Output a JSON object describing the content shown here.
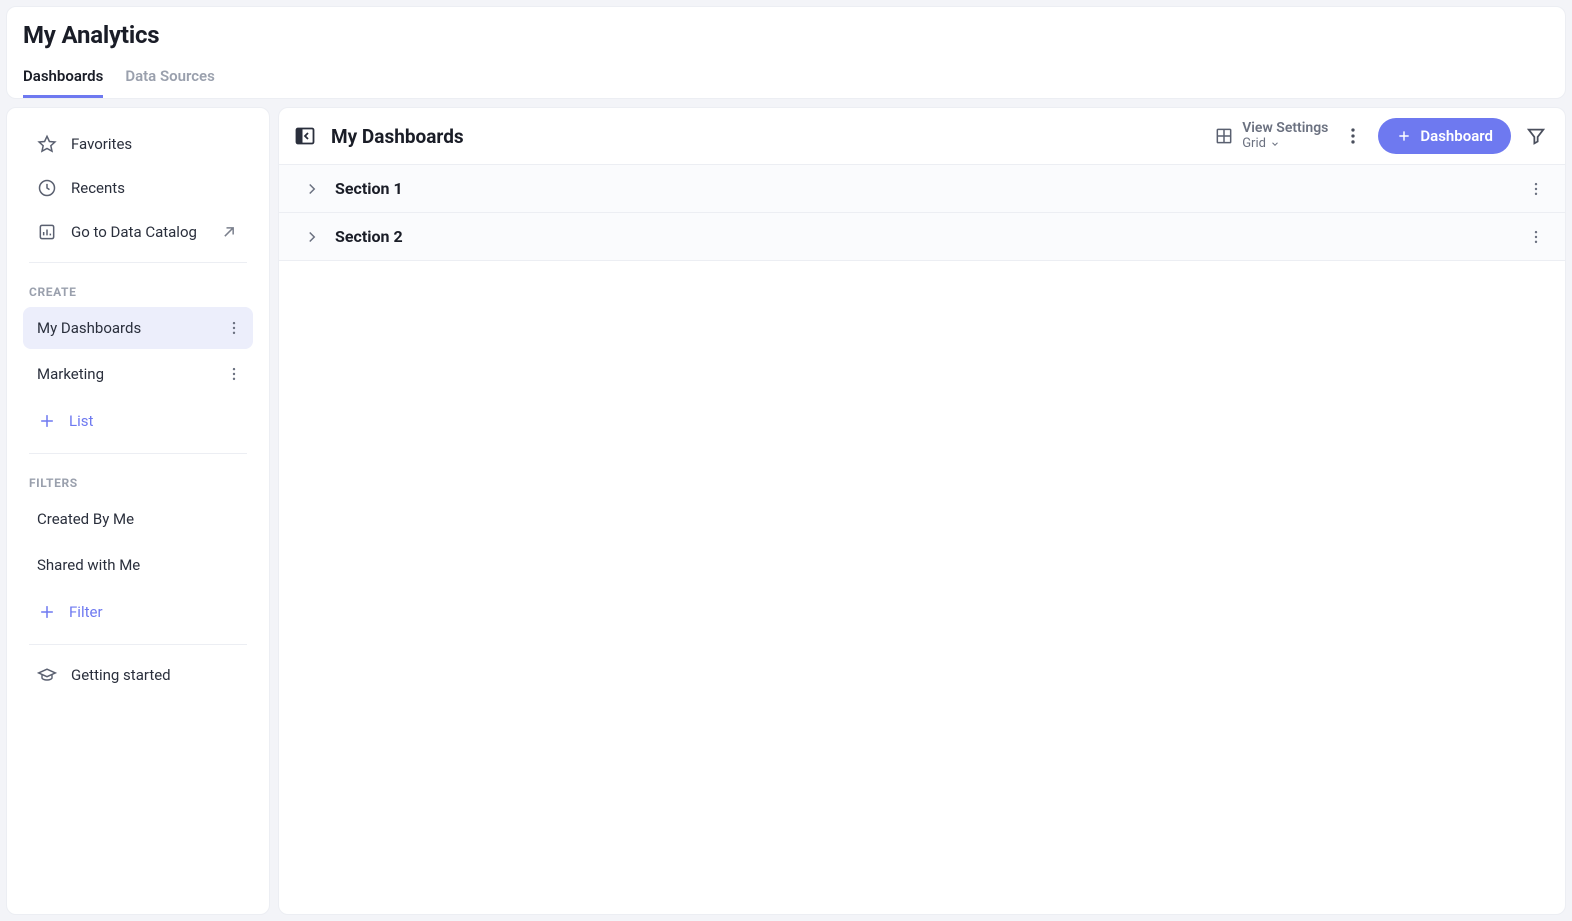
{
  "header": {
    "title": "My Analytics",
    "tabs": [
      {
        "label": "Dashboards",
        "active": true
      },
      {
        "label": "Data Sources",
        "active": false
      }
    ]
  },
  "sidebar": {
    "nav": {
      "favorites": "Favorites",
      "recents": "Recents",
      "catalog": "Go to Data Catalog"
    },
    "create": {
      "header": "CREATE",
      "items": [
        {
          "label": "My Dashboards",
          "active": true
        },
        {
          "label": "Marketing",
          "active": false
        }
      ],
      "add_label": "List"
    },
    "filters": {
      "header": "FILTERS",
      "items": [
        {
          "label": "Created By Me"
        },
        {
          "label": "Shared with Me"
        }
      ],
      "add_label": "Filter"
    },
    "getting_started": "Getting started"
  },
  "main": {
    "title": "My Dashboards",
    "view_settings": {
      "label": "View Settings",
      "value": "Grid"
    },
    "add_button": "Dashboard",
    "sections": [
      {
        "title": "Section 1"
      },
      {
        "title": "Section 2"
      }
    ]
  }
}
